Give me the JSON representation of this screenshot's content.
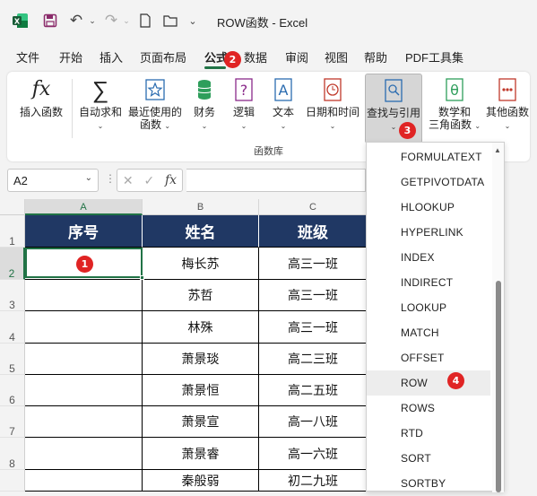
{
  "window": {
    "title": "ROW函数 - Excel",
    "accent_color": "#217346",
    "badge_color": "#e02424"
  },
  "menu": {
    "tabs": [
      "文件",
      "开始",
      "插入",
      "页面布局",
      "公式",
      "数据",
      "审阅",
      "视图",
      "帮助",
      "PDF工具集"
    ],
    "active_tab": "公式"
  },
  "ribbon": {
    "buttons": {
      "insert_function": "插入函数",
      "autosum_1": "自动求和",
      "recent_1": "最近使用的",
      "recent_2": "函数",
      "financial": "财务",
      "logical": "逻辑",
      "text": "文本",
      "datetime": "日期和时间",
      "lookup": "查找与引用",
      "math_1": "数学和",
      "math_2": "三角函数",
      "other": "其他函数"
    },
    "group_label": "函数库"
  },
  "formula_bar": {
    "name_box": "A2",
    "fx": "fx"
  },
  "sheet": {
    "columns": [
      "A",
      "B",
      "C"
    ],
    "rows": [
      "1",
      "2",
      "3",
      "4",
      "5",
      "6",
      "7",
      "8"
    ],
    "header_color": "#203864",
    "header": [
      "序号",
      "姓名",
      "班级"
    ],
    "data": [
      [
        "",
        "梅长苏",
        "高三一班"
      ],
      [
        "",
        "苏哲",
        "高三一班"
      ],
      [
        "",
        "林殊",
        "高三一班"
      ],
      [
        "",
        "萧景琰",
        "高二三班"
      ],
      [
        "",
        "萧景恒",
        "高二五班"
      ],
      [
        "",
        "萧景宣",
        "高一八班"
      ],
      [
        "",
        "萧景睿",
        "高一六班"
      ],
      [
        "",
        "秦般弱",
        "初二九班"
      ]
    ]
  },
  "dropdown": {
    "items": [
      "FORMULATEXT",
      "GETPIVOTDATA",
      "HLOOKUP",
      "HYPERLINK",
      "INDEX",
      "INDIRECT",
      "LOOKUP",
      "MATCH",
      "OFFSET",
      "ROW",
      "ROWS",
      "RTD",
      "SORT",
      "SORTBY"
    ],
    "highlighted": "ROW"
  },
  "badges": [
    "1",
    "2",
    "3",
    "4"
  ]
}
